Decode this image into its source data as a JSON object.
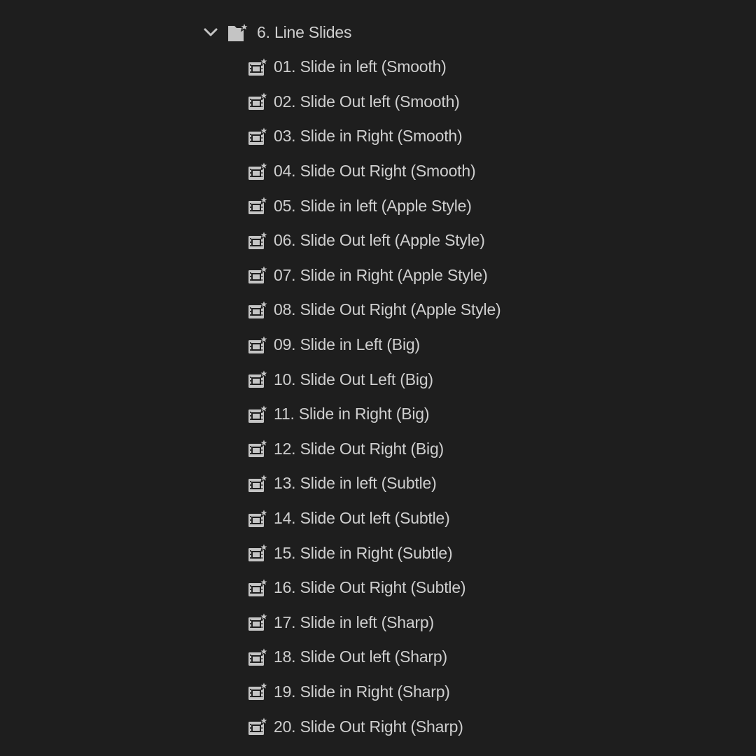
{
  "colors": {
    "background": "#1e1e1e",
    "text": "#cfcfcf",
    "icon": "#c4c4c4"
  },
  "folder": {
    "label": "6. Line Slides",
    "expanded": true,
    "toggle_icon": "chevron-down-icon",
    "icon": "bin-folder-star-icon"
  },
  "items": [
    {
      "label": "01. Slide in left (Smooth)",
      "icon": "effect-preset-icon"
    },
    {
      "label": "02. Slide Out left (Smooth)",
      "icon": "effect-preset-icon"
    },
    {
      "label": "03. Slide in Right (Smooth)",
      "icon": "effect-preset-icon"
    },
    {
      "label": "04. Slide Out Right (Smooth)",
      "icon": "effect-preset-icon"
    },
    {
      "label": "05. Slide in left (Apple Style)",
      "icon": "effect-preset-icon"
    },
    {
      "label": "06. Slide Out left (Apple Style)",
      "icon": "effect-preset-icon"
    },
    {
      "label": "07. Slide in Right (Apple Style)",
      "icon": "effect-preset-icon"
    },
    {
      "label": "08. Slide Out Right (Apple Style)",
      "icon": "effect-preset-icon"
    },
    {
      "label": "09. Slide in Left (Big)",
      "icon": "effect-preset-icon"
    },
    {
      "label": "10. Slide Out Left (Big)",
      "icon": "effect-preset-icon"
    },
    {
      "label": "11. Slide in Right (Big)",
      "icon": "effect-preset-icon"
    },
    {
      "label": "12. Slide Out Right (Big)",
      "icon": "effect-preset-icon"
    },
    {
      "label": "13. Slide in left (Subtle)",
      "icon": "effect-preset-icon"
    },
    {
      "label": "14. Slide Out left (Subtle)",
      "icon": "effect-preset-icon"
    },
    {
      "label": "15. Slide in Right (Subtle)",
      "icon": "effect-preset-icon"
    },
    {
      "label": "16. Slide Out Right (Subtle)",
      "icon": "effect-preset-icon"
    },
    {
      "label": "17. Slide in left (Sharp)",
      "icon": "effect-preset-icon"
    },
    {
      "label": "18. Slide Out left (Sharp)",
      "icon": "effect-preset-icon"
    },
    {
      "label": "19. Slide in Right (Sharp)",
      "icon": "effect-preset-icon"
    },
    {
      "label": "20. Slide Out Right (Sharp)",
      "icon": "effect-preset-icon"
    }
  ]
}
